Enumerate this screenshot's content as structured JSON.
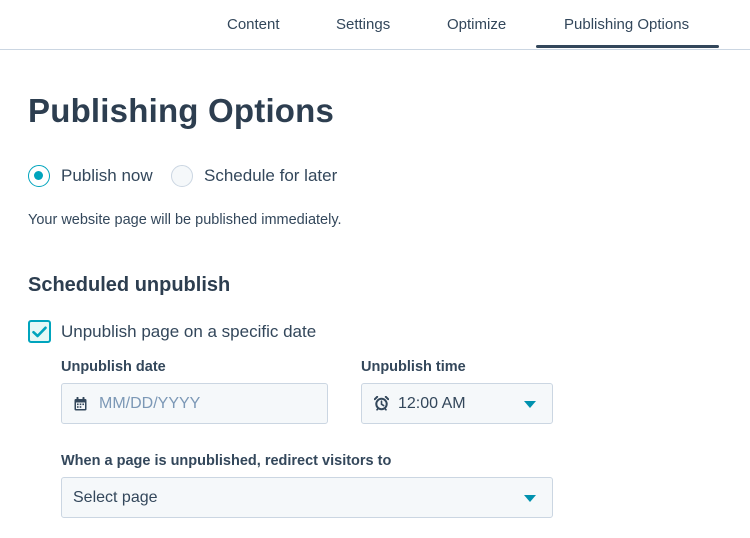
{
  "tabs": [
    {
      "label": "Content"
    },
    {
      "label": "Settings"
    },
    {
      "label": "Optimize"
    },
    {
      "label": "Publishing Options",
      "active": true
    }
  ],
  "page_title": "Publishing Options",
  "publish": {
    "options": [
      {
        "label": "Publish now",
        "checked": true
      },
      {
        "label": "Schedule for later",
        "checked": false
      }
    ],
    "help_text": "Your website page will be published immediately."
  },
  "unpublish": {
    "section_title": "Scheduled unpublish",
    "checkbox_label": "Unpublish page on a specific date",
    "checkbox_checked": true,
    "date_label": "Unpublish date",
    "date_placeholder": "MM/DD/YYYY",
    "time_label": "Unpublish time",
    "time_value": "12:00 AM",
    "redirect_label": "When a page is unpublished, redirect visitors to",
    "redirect_placeholder": "Select page"
  },
  "icons": {
    "calendar": "calendar-icon",
    "clock": "alarm-clock-icon",
    "caret": "caret-down-icon",
    "check": "checkmark-icon"
  },
  "colors": {
    "accent": "#00a4bd",
    "caret": "#0091ae",
    "text": "#33475b",
    "heading": "#2d3e50",
    "border": "#cbd6e2",
    "field_bg": "#f5f8fa",
    "placeholder": "#7c98b6"
  }
}
